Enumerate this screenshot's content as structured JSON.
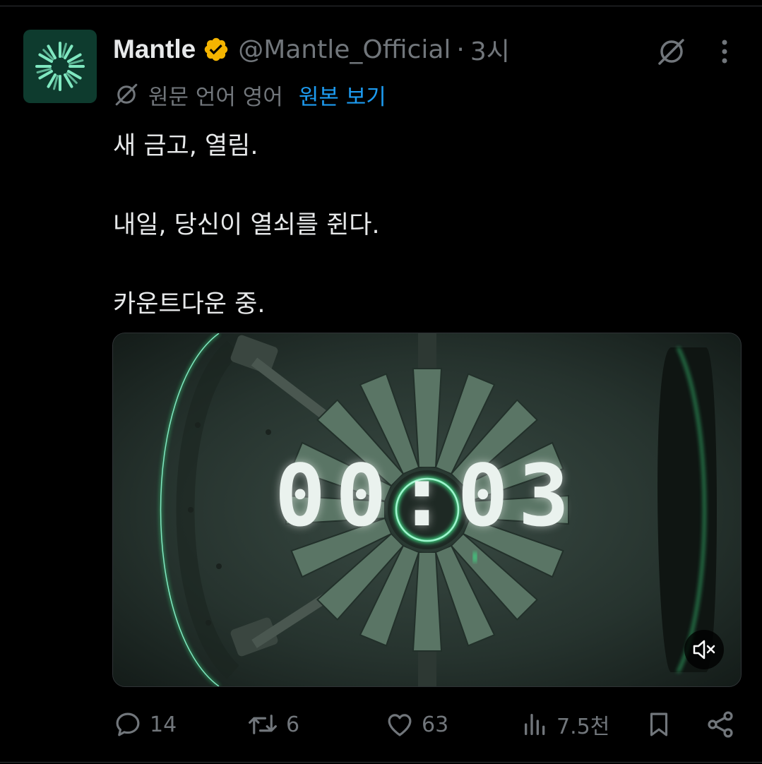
{
  "tweet": {
    "display_name": "Mantle",
    "handle": "@Mantle_Official",
    "separator": "·",
    "time": "3시",
    "translation_label": "원문 언어 영어",
    "show_original": "원본 보기",
    "lines": [
      "새 금고, 열림.",
      "내일, 당신이 열쇠를 쥔다.",
      "카운트다운 중."
    ]
  },
  "media": {
    "countdown": [
      "0",
      "0",
      ":",
      "0",
      "3"
    ]
  },
  "actions": {
    "replies": "14",
    "reposts": "6",
    "likes": "63",
    "views": "7.5천"
  },
  "icons": {
    "avatar": "mantle-logo",
    "verified": "verified-badge-icon",
    "grok": "grok-icon",
    "more": "more-icon",
    "translate": "translate-icon",
    "mute": "mute-icon",
    "reply": "reply-icon",
    "repost": "repost-icon",
    "like": "like-icon",
    "views": "views-icon",
    "bookmark": "bookmark-icon",
    "share": "share-icon"
  },
  "colors": {
    "accent": "#1d9bf0",
    "verified": "#f4b400",
    "brand": "#0e3b2e",
    "glow": "#3ddc84"
  }
}
